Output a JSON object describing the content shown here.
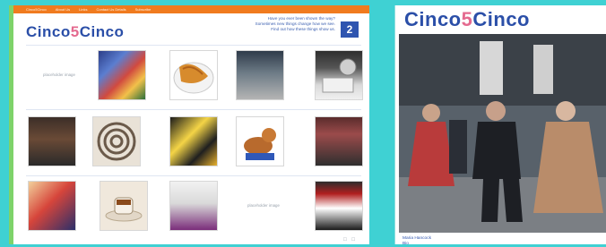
{
  "nav": {
    "items": [
      "Cinco5Cinco",
      "About Us",
      "Links",
      "Contact Us Details",
      "Subscribe"
    ]
  },
  "site": {
    "logo_part1": "Cinco",
    "logo_part2": "5",
    "logo_part3": "Cinco"
  },
  "intro": {
    "line1": "Have you ever been shown the way?",
    "line2": "Sometimes new things change how we see.",
    "line3": "Find out how these things show us."
  },
  "page_indicator": "2",
  "grid": {
    "row1": {
      "placeholder1": "placeholder image"
    },
    "row3": {
      "placeholder2": "placeholder image"
    }
  },
  "right": {
    "caption_name": "Maria Hancock",
    "caption_sub": "Bio"
  },
  "colors": {
    "background": "#3fd1d3",
    "nav_orange": "#f07b1f",
    "brand_blue": "#2b4fa8",
    "brand_pink": "#e46a8f",
    "accent_green": "#7ed36a"
  }
}
